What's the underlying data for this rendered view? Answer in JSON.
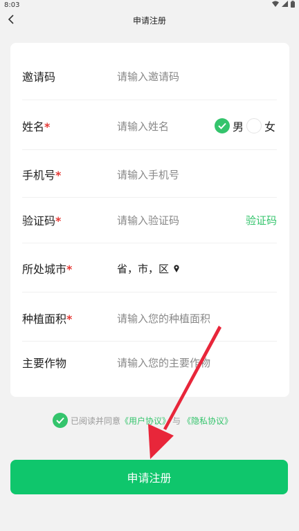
{
  "status_bar": {
    "time": "8:03"
  },
  "header": {
    "title": "申请注册",
    "back_icon": "chevron-left-icon"
  },
  "form": {
    "invite": {
      "label": "邀请码",
      "placeholder": "请输入邀请码"
    },
    "name": {
      "label": "姓名",
      "required": "*",
      "placeholder": "请输入姓名"
    },
    "gender": {
      "male": "男",
      "female": "女",
      "selected": "男"
    },
    "phone": {
      "label": "手机号",
      "required": "*",
      "placeholder": "请输入手机号"
    },
    "code": {
      "label": "验证码",
      "required": "*",
      "placeholder": "请输入验证码",
      "action": "验证码"
    },
    "city": {
      "label": "所处城市",
      "required": "*",
      "value": "省，市，区"
    },
    "area": {
      "label": "种植面积",
      "required": "*",
      "placeholder": "请输入您的种植面积"
    },
    "crop": {
      "label": "主要作物",
      "placeholder": "请输入您的主要作物"
    }
  },
  "agreement": {
    "prefix": "已阅读并同意",
    "user_agreement": "《用户协议》",
    "joiner": "与",
    "privacy": "《隐私协议》",
    "checked": true
  },
  "submit": {
    "label": "申请注册"
  },
  "colors": {
    "accent": "#34c46c",
    "button": "#0fc66c",
    "required": "#e53935",
    "annotation_arrow": "#e8263a"
  }
}
